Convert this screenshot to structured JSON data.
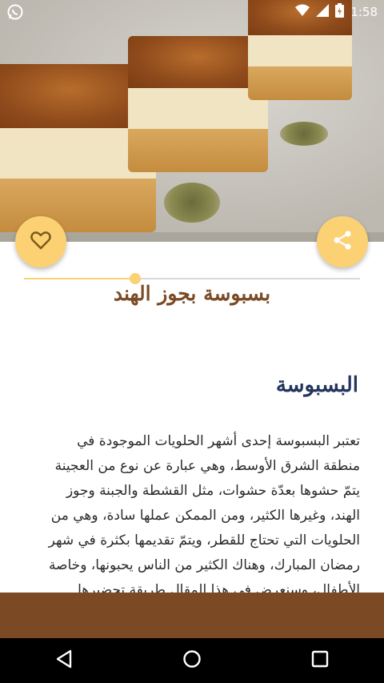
{
  "status_bar": {
    "time": "1:58",
    "left_icon": "whatsapp-icon",
    "right_icons": [
      "wifi-icon",
      "signal-icon",
      "battery-icon"
    ]
  },
  "hero": {
    "icon": "food-photo"
  },
  "actions": {
    "favorite_icon": "heart-outline-icon",
    "share_icon": "share-icon",
    "accent_color": "#fbd173"
  },
  "reading_progress": 0.33,
  "recipe": {
    "title": "بسبوسة بجوز الهند",
    "section_heading": "البسبوسة",
    "body_lines": [
      "تعتبر البسبوسة إحدى أشهر الحلويات الموجودة في",
      "منطقة الشرق الأوسط، وهي عبارة عن نوع من العجينة",
      "يتمّ حشوها بعدّة حشوات، مثل القشطة والجبنة وجوز",
      "الهند، وغيرها الكثير، ومن الممكن عملها سادة، وهي من",
      "الحلويات التي تحتاج للقطر، ويتمّ تقديمها بكثرة في شهر",
      "رمضان المبارك، وهناك الكثير من الناس يحبونها، وخاصة",
      "الأطفال، وسنعرض في هذا المقال طريقة تحضيرها"
    ]
  },
  "colors": {
    "title": "#7b4a24",
    "heading": "#24355e",
    "bottom_bar": "#7b4a24"
  },
  "nav_bar": {
    "icons": [
      "back-icon",
      "home-icon",
      "recents-icon"
    ]
  }
}
